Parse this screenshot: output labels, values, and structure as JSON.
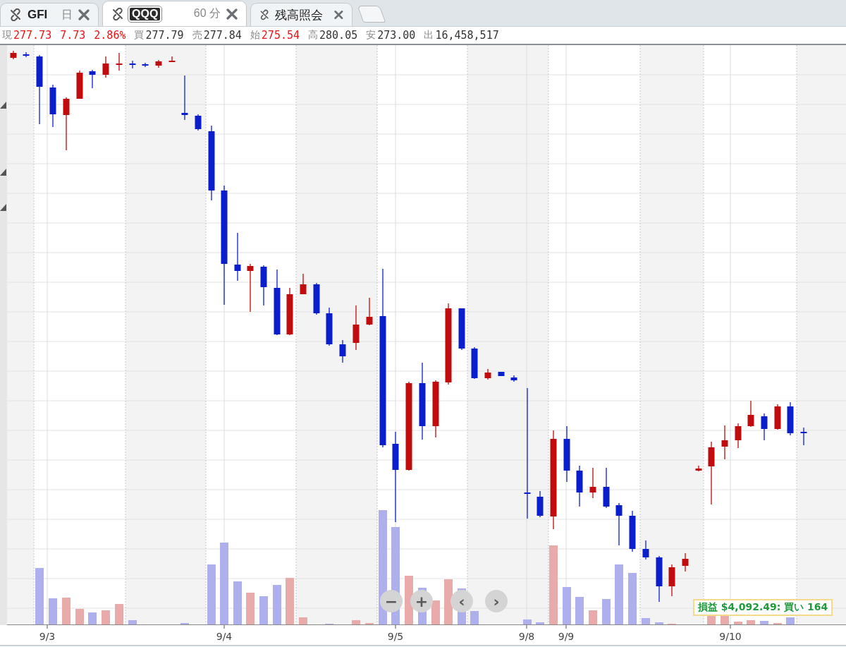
{
  "tabs": [
    {
      "label": "GFI",
      "interval": "日",
      "selected": false,
      "highlighted": false
    },
    {
      "label": "QQQ",
      "interval": "60 分",
      "selected": true,
      "highlighted": true
    },
    {
      "label": "残高照会",
      "selected": false,
      "highlighted": false
    }
  ],
  "quote": [
    {
      "label": "現",
      "value": "277.73",
      "color": "#ee1111"
    },
    {
      "value": "7.73",
      "color": "#ee1111"
    },
    {
      "value": "2.86%",
      "color": "#ee1111"
    },
    {
      "label": "買",
      "value": "277.79",
      "color": "#333333"
    },
    {
      "label": "売",
      "value": "277.84",
      "color": "#333333"
    },
    {
      "label": "始",
      "value": "275.54",
      "color": "#ee1111"
    },
    {
      "label": "高",
      "value": "280.05",
      "color": "#333333"
    },
    {
      "label": "安",
      "value": "273.00",
      "color": "#333333"
    },
    {
      "label": "出",
      "value": "16,458,517",
      "color": "#333333"
    }
  ],
  "chart": {
    "dates": [
      "9/3",
      "9/4",
      "9/5",
      "9/8",
      "9/9",
      "9/10"
    ],
    "controls": [
      "−",
      "+",
      "‹",
      "›"
    ],
    "position_label": "損益 $4,092.49: 買い 164"
  }
}
